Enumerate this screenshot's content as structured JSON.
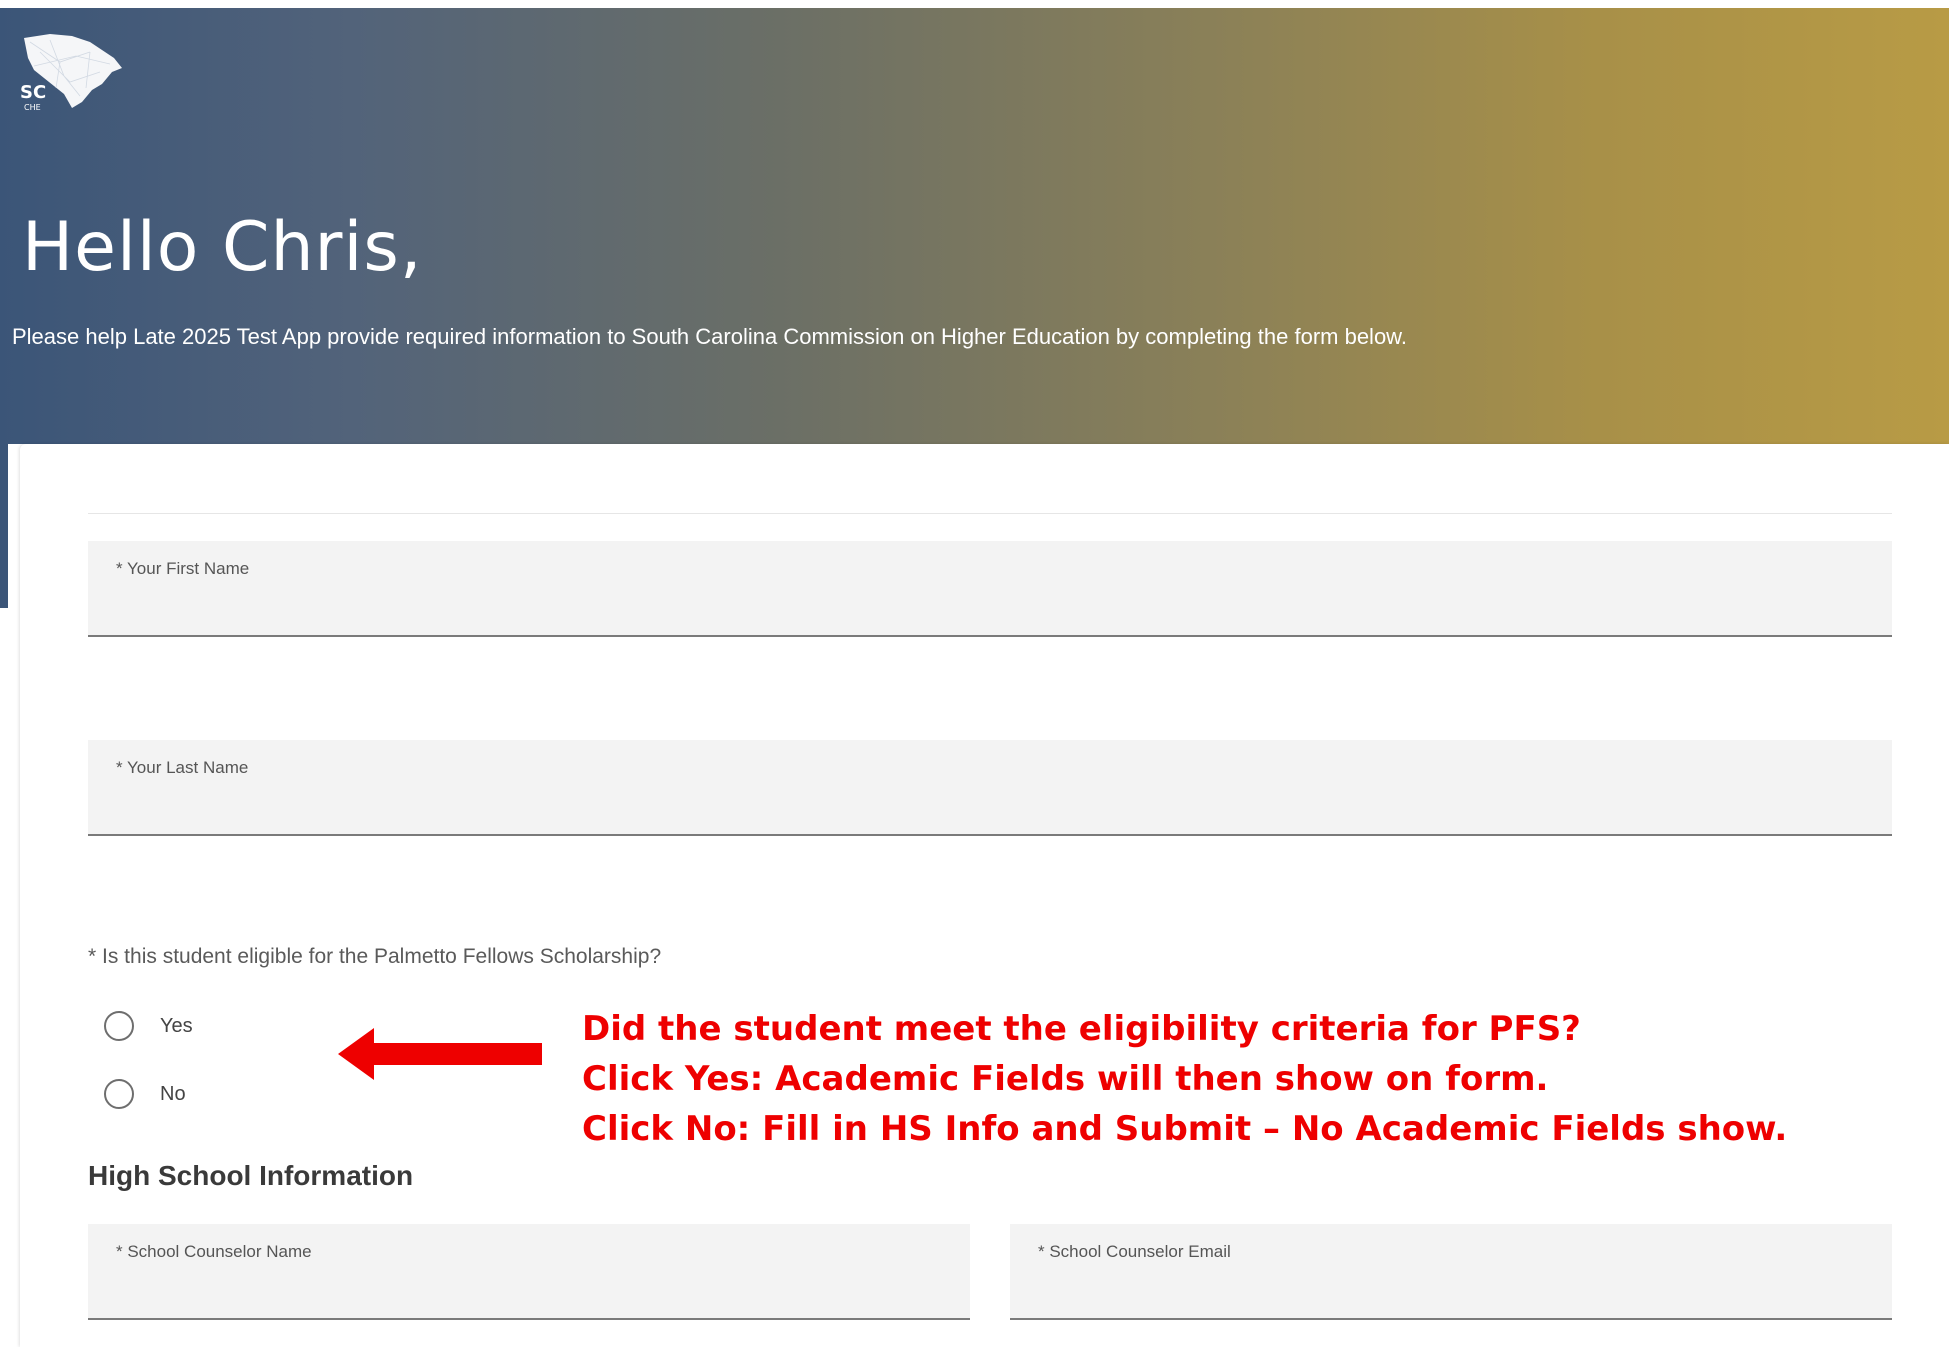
{
  "header": {
    "logo_text": "SC",
    "logo_subtext": "CHE",
    "greeting": "Hello Chris,",
    "description": "Please help Late 2025 Test App provide required information to South Carolina Commission on Higher Education by completing the form below."
  },
  "form": {
    "first_name": {
      "label": "* Your First Name",
      "value": ""
    },
    "last_name": {
      "label": "* Your Last Name",
      "value": ""
    },
    "eligibility": {
      "question": "* Is this student eligible for the Palmetto Fellows Scholarship?",
      "options": [
        "Yes",
        "No"
      ]
    },
    "high_school": {
      "heading": "High School Information",
      "counselor_name": {
        "label": "* School Counselor Name",
        "value": ""
      },
      "counselor_email": {
        "label": "* School Counselor Email",
        "value": ""
      }
    }
  },
  "annotation": {
    "lines": [
      "Did the student meet the eligibility criteria for PFS?",
      "Click Yes: Academic Fields will then show on form.",
      "Click No: Fill in HS Info and Submit – No Academic Fields show."
    ],
    "color": "#ee0000"
  },
  "colors": {
    "banner_start": "#3b5578",
    "banner_end": "#b89b45",
    "field_background": "#f3f3f3"
  }
}
